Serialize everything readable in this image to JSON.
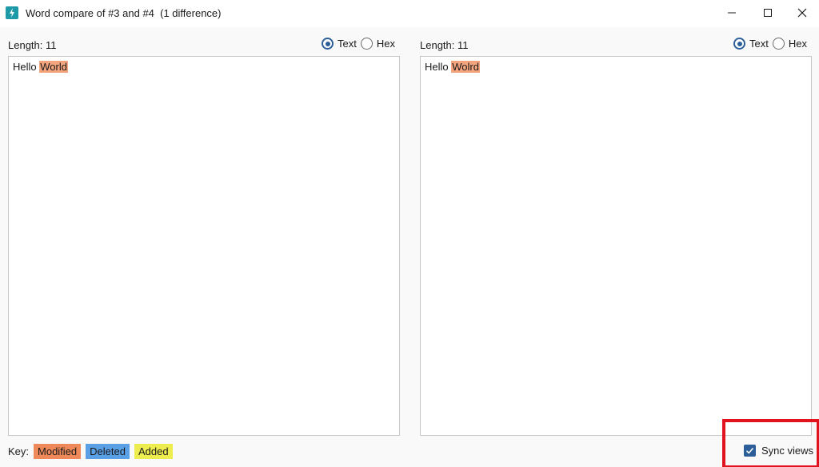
{
  "window": {
    "title": "Word compare of #3 and #4  (1 difference)",
    "icon": "app-lightning-icon",
    "buttons": [
      "minimize-icon",
      "maximize-icon",
      "close-icon"
    ]
  },
  "left_pane": {
    "length_label": "Length: 11",
    "mode_text": "Text",
    "mode_hex": "Hex",
    "selected_mode": "Text",
    "content_plain": "Hello ",
    "content_diff": "World"
  },
  "right_pane": {
    "length_label": "Length: 11",
    "mode_text": "Text",
    "mode_hex": "Hex",
    "selected_mode": "Text",
    "content_plain": "Hello ",
    "content_diff": "Wolrd"
  },
  "key": {
    "label": "Key:",
    "modified": "Modified",
    "deleted": "Deleted",
    "added": "Added",
    "colors": {
      "modified": "#f0895a",
      "deleted": "#5aa0e6",
      "added": "#eded4f"
    }
  },
  "sync": {
    "label": "Sync views",
    "checked": true
  },
  "colors": {
    "diff_highlight": "#f4a57e",
    "accent": "#2c5f9a",
    "annotation_box": "#e0131f"
  }
}
